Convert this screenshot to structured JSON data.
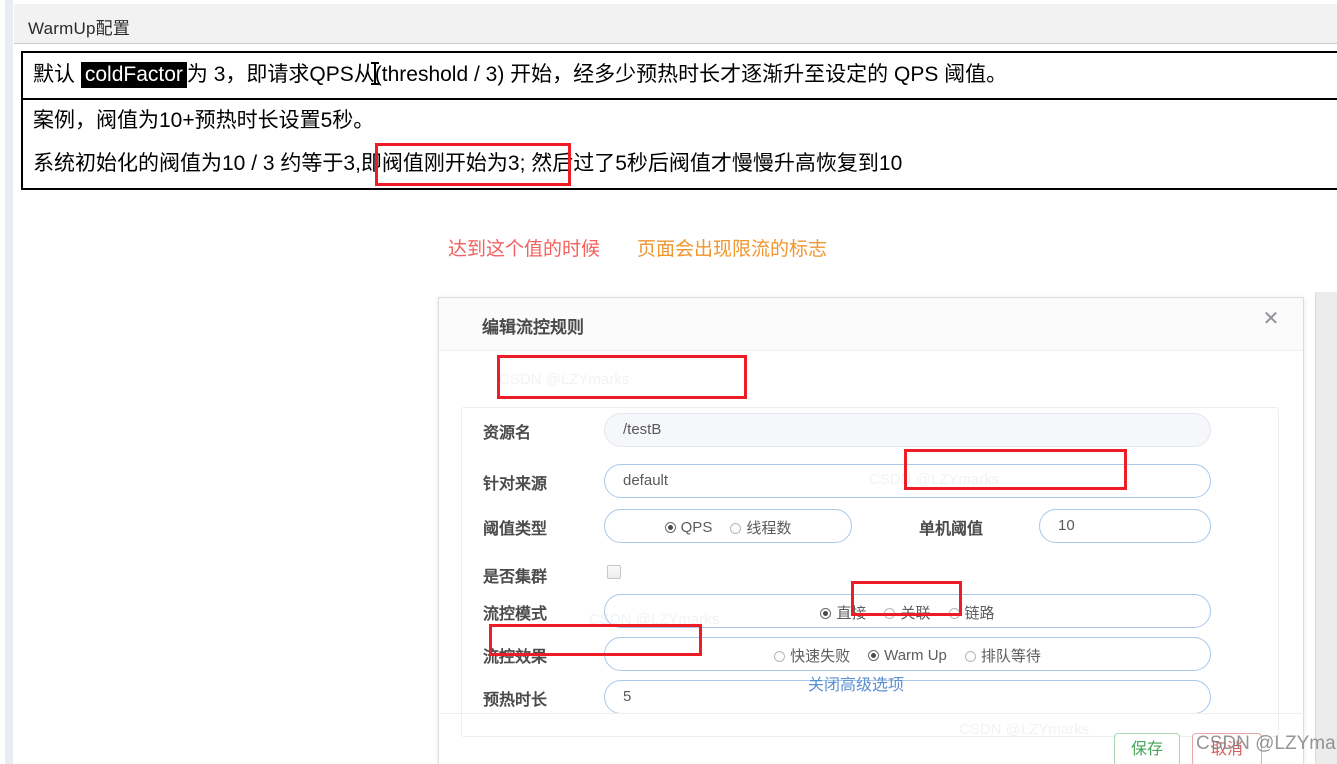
{
  "document": {
    "header_title": "WarmUp配置",
    "lines": {
      "line1_a": "默认 ",
      "line1_highlight": "coldFactor",
      "line1_b": "为 3，即请求QPS从",
      "line1_c": "(threshold / 3) 开始，经多少预热时长才逐渐升至设定的 QPS 阈值。",
      "line2": "案例，阀值为10+预热时长设置5秒。",
      "line3_a": "系统初始化的阀值为10 / 3 约等于3",
      "line3_b": ",即阀值刚开始为3;",
      "line3_c": " 然后过了5秒后阀值才慢慢升高恢复到10"
    }
  },
  "annotations": {
    "red_note": "达到这个值的时候",
    "orange_note": "页面会出现限流的标志",
    "red_color": "#f4615e",
    "orange_color": "#f0962f",
    "highlight_box_color": "#ee1c25"
  },
  "dialog": {
    "title": "编辑流控规则",
    "close_icon": "close-icon",
    "fields": {
      "resource_name": {
        "label": "资源名",
        "value": "/testB"
      },
      "origin": {
        "label": "针对来源",
        "value": "default"
      },
      "threshold_type": {
        "label": "阈值类型",
        "options": [
          {
            "label": "QPS",
            "selected": true
          },
          {
            "label": "线程数",
            "selected": false
          }
        ]
      },
      "single_threshold": {
        "label": "单机阈值",
        "value": "10"
      },
      "cluster": {
        "label": "是否集群",
        "checked": false
      },
      "flow_mode": {
        "label": "流控模式",
        "options": [
          {
            "label": "直接",
            "selected": true
          },
          {
            "label": "关联",
            "selected": false
          },
          {
            "label": "链路",
            "selected": false
          }
        ]
      },
      "flow_effect": {
        "label": "流控效果",
        "options": [
          {
            "label": "快速失败",
            "selected": false
          },
          {
            "label": "Warm Up",
            "selected": true
          },
          {
            "label": "排队等待",
            "selected": false
          }
        ]
      },
      "warmup_duration": {
        "label": "预热时长",
        "value": "5"
      }
    },
    "advanced_link": "关闭高级选项",
    "buttons": {
      "save": "保存",
      "cancel": "取消"
    }
  },
  "watermark": {
    "text": "CSDN @LZYmarks",
    "faint": "CSDN @LZYmarks"
  }
}
